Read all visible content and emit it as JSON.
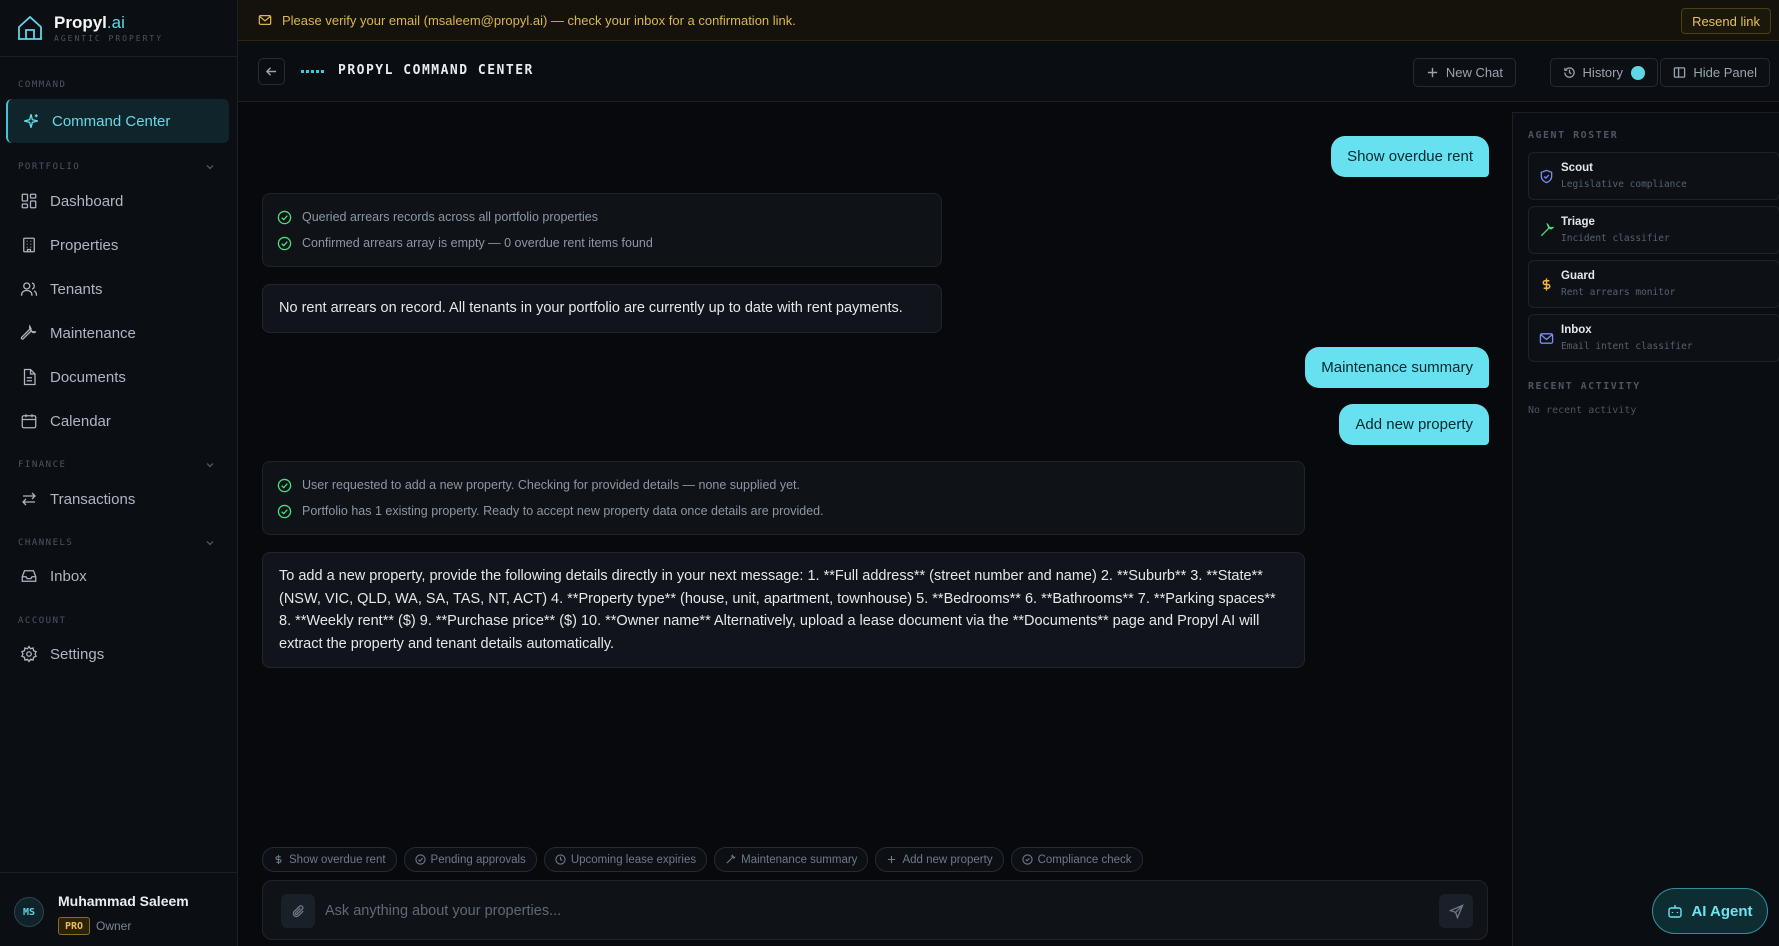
{
  "brand": {
    "name": "Propyl",
    "suffix": ".ai",
    "tagline": "AGENTIC PROPERTY"
  },
  "sidebar": {
    "sections": {
      "command": "COMMAND",
      "portfolio": "PORTFOLIO",
      "finance": "FINANCE",
      "channels": "CHANNELS",
      "account": "ACCOUNT"
    },
    "items": [
      {
        "label": "Command Center"
      },
      {
        "label": "Dashboard"
      },
      {
        "label": "Properties"
      },
      {
        "label": "Tenants"
      },
      {
        "label": "Maintenance"
      },
      {
        "label": "Documents"
      },
      {
        "label": "Calendar"
      },
      {
        "label": "Transactions"
      },
      {
        "label": "Inbox"
      },
      {
        "label": "Settings"
      }
    ]
  },
  "user": {
    "initials": "MS",
    "name": "Muhammad Saleem",
    "plan": "PRO",
    "role": "Owner"
  },
  "banner": {
    "message": "Please verify your email (msaleem@propyl.ai) — check your inbox for a confirmation link.",
    "action": "Resend link"
  },
  "header": {
    "title": "PROPYL COMMAND CENTER",
    "new_chat": "New Chat",
    "history": "History",
    "hide_panel": "Hide Panel"
  },
  "messages": {
    "user1": "Show overdue rent",
    "tools1": [
      "Queried arrears records across all portfolio properties",
      "Confirmed arrears array is empty — 0 overdue rent items found"
    ],
    "ai1": "No rent arrears on record. All tenants in your portfolio are currently up to date with rent payments.",
    "user2": "Maintenance summary",
    "user3": "Add new property",
    "tools2": [
      "User requested to add a new property. Checking for provided details — none supplied yet.",
      "Portfolio has 1 existing property. Ready to accept new property data once details are provided."
    ],
    "ai2": "To add a new property, provide the following details directly in your next message: 1. **Full address** (street number and name) 2. **Suburb** 3. **State** (NSW, VIC, QLD, WA, SA, TAS, NT, ACT) 4. **Property type** (house, unit, apartment, townhouse) 5. **Bedrooms** 6. **Bathrooms** 7. **Parking spaces** 8. **Weekly rent** ($) 9. **Purchase price** ($) 10. **Owner name** Alternatively, upload a lease document via the **Documents** page and Propyl AI will extract the property and tenant details automatically."
  },
  "chips": [
    "Show overdue rent",
    "Pending approvals",
    "Upcoming lease expiries",
    "Maintenance summary",
    "Add new property",
    "Compliance check"
  ],
  "input": {
    "placeholder": "Ask anything about your properties..."
  },
  "panel": {
    "roster_label": "AGENT ROSTER",
    "agents": [
      {
        "name": "Scout",
        "desc": "Legislative compliance",
        "color": "#7c8cf0"
      },
      {
        "name": "Triage",
        "desc": "Incident classifier",
        "color": "#4ade80"
      },
      {
        "name": "Guard",
        "desc": "Rent arrears monitor",
        "color": "#f5b341"
      },
      {
        "name": "Inbox",
        "desc": "Email intent classifier",
        "color": "#7c8cf0"
      }
    ],
    "activity_label": "RECENT ACTIVITY",
    "activity_empty": "No recent activity"
  },
  "ai_agent_button": "AI Agent",
  "colors": {
    "accent": "#5fd6e6",
    "warning": "#d9b64c",
    "success": "#4ade80"
  }
}
